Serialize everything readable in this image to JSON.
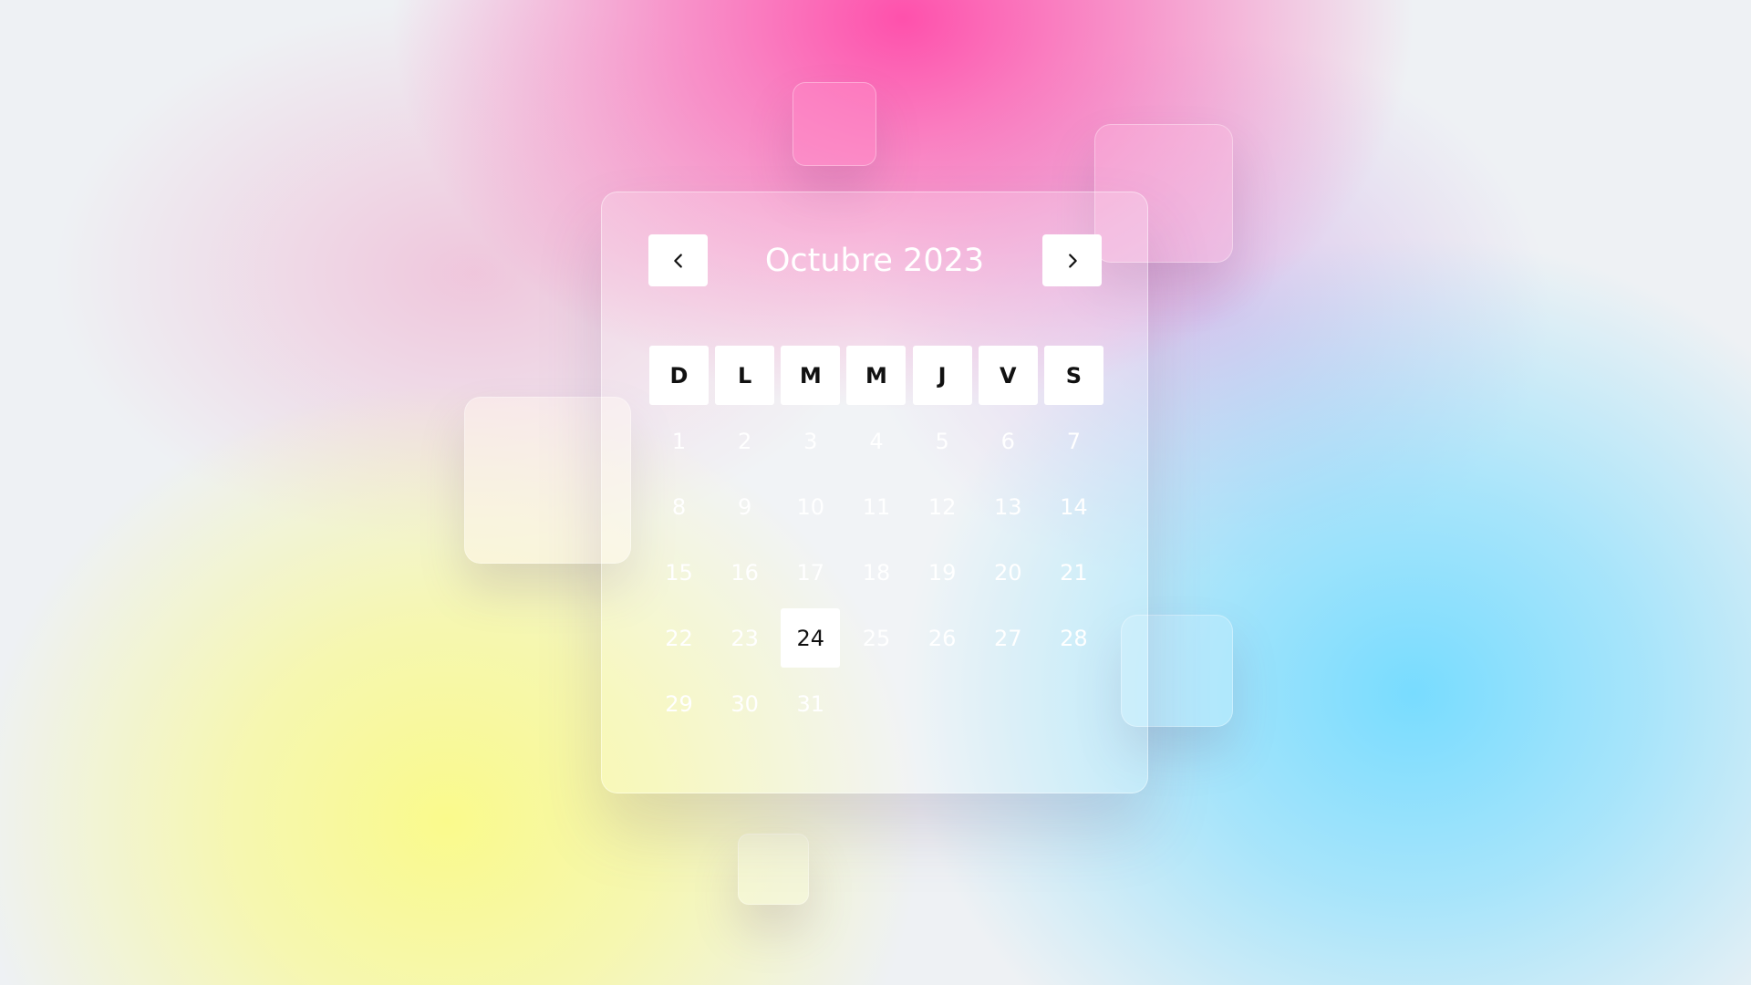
{
  "calendar": {
    "title": "Octubre 2023",
    "prev_icon": "chevron-left-icon",
    "next_icon": "chevron-right-icon",
    "weekdays": [
      "D",
      "L",
      "M",
      "M",
      "J",
      "V",
      "S"
    ],
    "weeks": [
      [
        "1",
        "2",
        "3",
        "4",
        "5",
        "6",
        "7"
      ],
      [
        "8",
        "9",
        "10",
        "11",
        "12",
        "13",
        "14"
      ],
      [
        "15",
        "16",
        "17",
        "18",
        "19",
        "20",
        "21"
      ],
      [
        "22",
        "23",
        "24",
        "25",
        "26",
        "27",
        "28"
      ],
      [
        "29",
        "30",
        "31",
        "",
        "",
        "",
        ""
      ]
    ],
    "selected_day": "24"
  },
  "colors": {
    "accent_pink": "#ff48a8",
    "accent_yellow": "#fafa8c",
    "accent_cyan": "#78dcff",
    "text_on_glass": "#ffffff",
    "text_dark": "#111111"
  }
}
